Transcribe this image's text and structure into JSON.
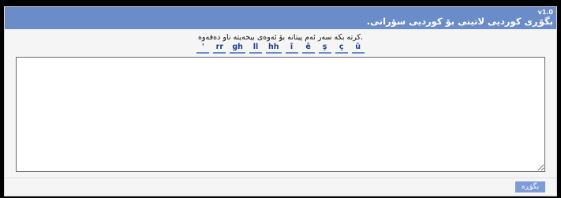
{
  "header": {
    "version": "v1.0",
    "title": "بگۆڕی کوردیی لاتینی بۆ کوردیی سۆرانی."
  },
  "instruction": ".کرتە بکە سەر ئەم پیتانە بۆ ئەوەی بیخەیتە ناو دەقەوە",
  "characters": [
    "'",
    "rr",
    "gh",
    "ll",
    "hh",
    "î",
    "ê",
    "ş",
    "ç",
    "û"
  ],
  "editor": {
    "value": "",
    "placeholder": ""
  },
  "buttons": {
    "convert_label": "بگۆڕە"
  },
  "colors": {
    "header": "#6a8cc8",
    "button": "#7d9bd4",
    "char_text": "#1f3f88"
  }
}
